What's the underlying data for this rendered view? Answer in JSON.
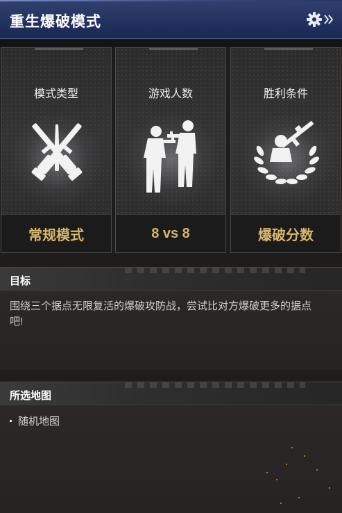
{
  "header": {
    "title": "重生爆破模式",
    "settings_icon": "gear-icon",
    "expand_icon": "double-chevron-right-icon"
  },
  "cards": [
    {
      "label": "模式类型",
      "value": "常规模式",
      "icon": "crossed-rifles-icon"
    },
    {
      "label": "游戏人数",
      "value": "8 vs 8",
      "icon": "two-soldiers-icon"
    },
    {
      "label": "胜利条件",
      "value": "爆破分数",
      "icon": "laurel-soldier-icon"
    }
  ],
  "objective": {
    "title": "目标",
    "text": "围绕三个据点无限复活的爆破攻防战，尝试比对方爆破更多的据点吧!"
  },
  "maps": {
    "title": "所选地图",
    "items": [
      "随机地图"
    ]
  },
  "colors": {
    "header_blue": "#243260",
    "value_gold": "#d9b66b",
    "background": "#1f1d1c"
  }
}
